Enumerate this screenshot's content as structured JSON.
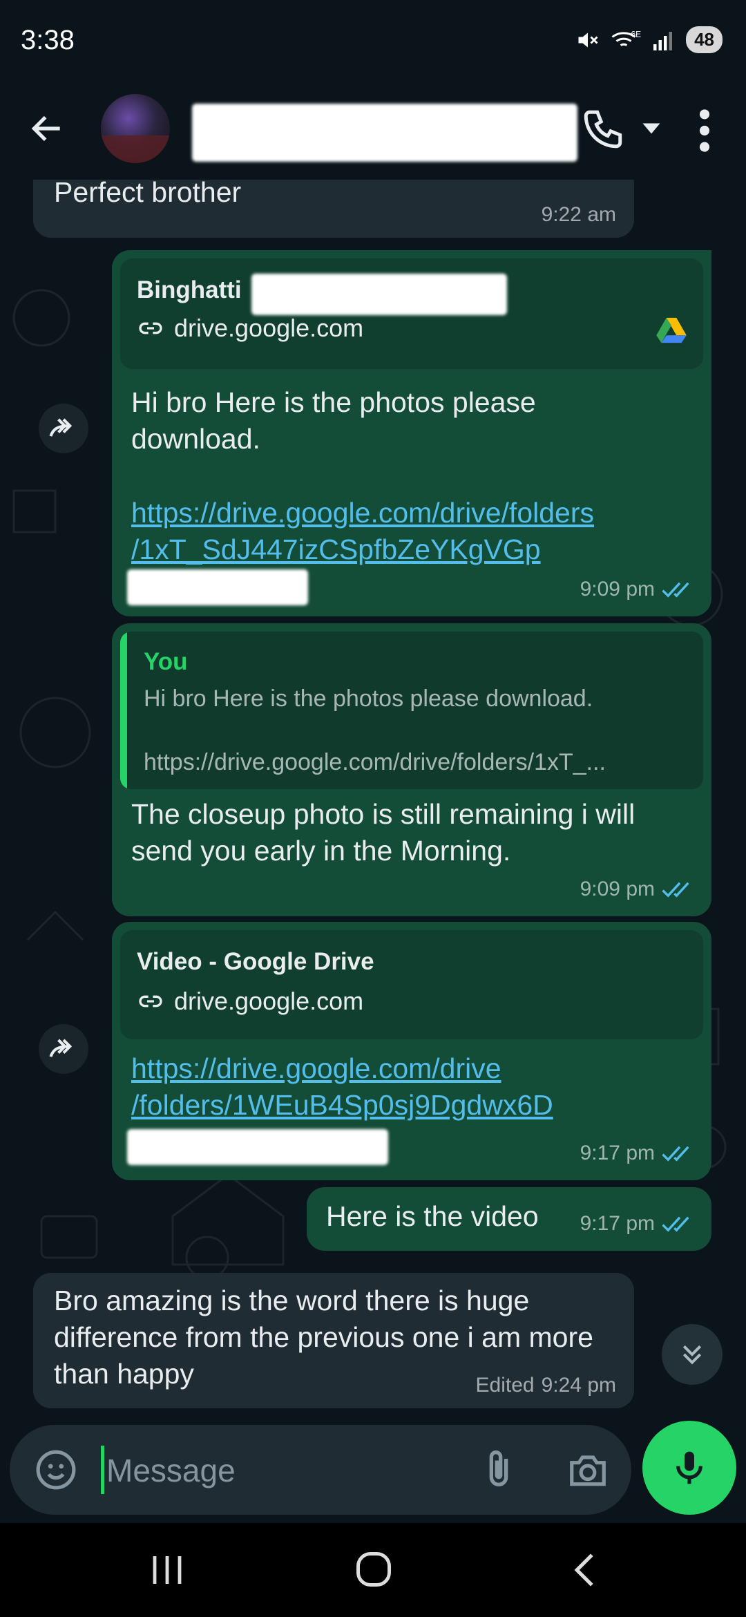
{
  "status_bar": {
    "time": "3:38",
    "battery": "48",
    "icons": [
      "mute-icon",
      "wifi-6e-icon",
      "signal-icon",
      "battery-icon"
    ]
  },
  "app_bar": {
    "back_icon": "arrow-left-icon",
    "call_icon": "phone-icon",
    "menu_icon": "more-vertical-icon"
  },
  "messages": {
    "m1": {
      "text": "Perfect brother",
      "time": "9:22 am"
    },
    "m2": {
      "preview_title": "Binghatti",
      "preview_domain": "drive.google.com",
      "text": "Hi bro Here is the photos please download.",
      "link": "https://drive.google.com/drive/folders/1xT_SdJ447izCSpfbZeYKgVGp",
      "link_line1": "https://drive.google.com/drive/folders",
      "link_line2": "/1xT_SdJ447izCSpfbZeYKgVGp",
      "time": "9:09 pm"
    },
    "m3": {
      "quote_author": "You",
      "quote_line1": "Hi bro Here is the photos please download.",
      "quote_line2": "https://drive.google.com/drive/folders/1xT_...",
      "text": "The closeup photo is still remaining i will send you early in the Morning.",
      "time": "9:09 pm"
    },
    "m4": {
      "preview_title": "Video - Google Drive",
      "preview_domain": "drive.google.com",
      "link_line1": "https://drive.google.com/drive",
      "link_line2": "/folders/1WEuB4Sp0sj9Dgdwx6D",
      "time": "9:17 pm"
    },
    "m5": {
      "text": "Here is the video",
      "time": "9:17 pm"
    },
    "m6": {
      "text": "Bro amazing is the word there is huge difference from the previous one i am more than happy",
      "edited_label": "Edited",
      "time": "9:24 pm"
    }
  },
  "composer": {
    "placeholder": "Message",
    "emoji_icon": "sticker-emoji-icon",
    "attach_icon": "paperclip-icon",
    "camera_icon": "camera-icon",
    "mic_icon": "microphone-icon"
  },
  "colors": {
    "background": "#0b141a",
    "incoming": "#202c33",
    "outgoing": "#144d37",
    "accent": "#25d366",
    "link": "#53bdeb",
    "read_ticks": "#53bdeb"
  }
}
